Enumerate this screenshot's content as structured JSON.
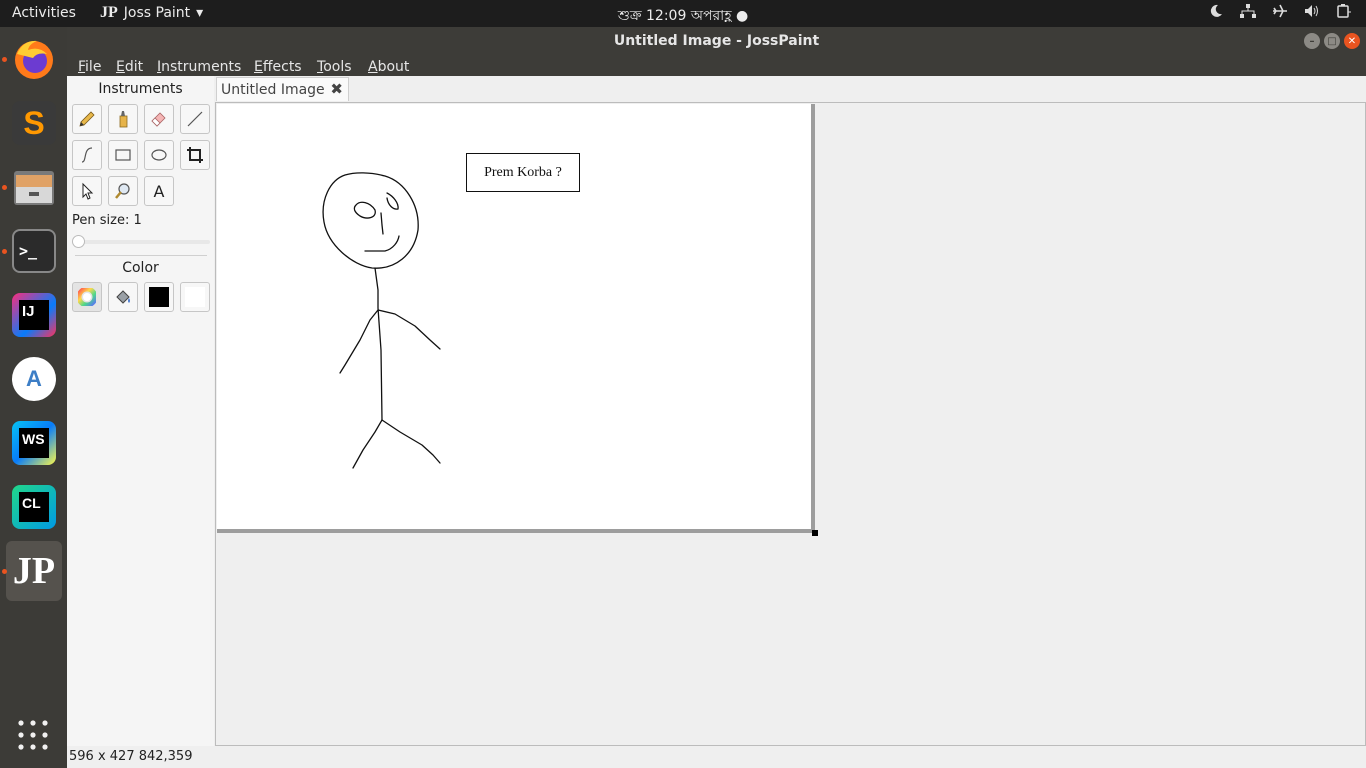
{
  "topbar": {
    "activities": "Activities",
    "app_name": "Joss Paint",
    "app_badge": "JP",
    "app_menu_arrow": "▾",
    "clock": "শুক্র 12:09 অপরাহ্ণ ●",
    "tray_icons": [
      "night-light-icon",
      "network-icon",
      "airplane-icon",
      "volume-icon",
      "battery-icon"
    ]
  },
  "dock": {
    "items": [
      {
        "name": "firefox",
        "running": true
      },
      {
        "name": "sublime-text",
        "running": false,
        "label": "S"
      },
      {
        "name": "files",
        "running": true
      },
      {
        "name": "terminal",
        "running": true,
        "label": ">_"
      },
      {
        "name": "intellij-idea",
        "running": false,
        "label": "IJ"
      },
      {
        "name": "android-studio",
        "running": false,
        "label": "A"
      },
      {
        "name": "webstorm",
        "running": false,
        "label": "WS"
      },
      {
        "name": "clion",
        "running": false,
        "label": "CL"
      },
      {
        "name": "josspaint",
        "running": true,
        "label": "JP"
      }
    ]
  },
  "window": {
    "title": "Untitled Image - JossPaint"
  },
  "menubar": {
    "items": [
      "File",
      "Edit",
      "Instruments",
      "Effects",
      "Tools",
      "About"
    ],
    "mnemonics": [
      "F",
      "E",
      "I",
      "E",
      "T",
      "A"
    ]
  },
  "panel": {
    "instruments_title": "Instruments",
    "text_tool_label": "A",
    "pen_size_label": "Pen size: 1",
    "pen_size_value": 1,
    "color_title": "Color",
    "primary_color": "#000000",
    "secondary_color": "#ffffff"
  },
  "tab": {
    "label": "Untitled Image",
    "close": "✖"
  },
  "canvas": {
    "speech_text": "Prem Korba ?"
  },
  "status": {
    "text": "596 x 427  842,359"
  },
  "colors": {
    "accent": "#e95420",
    "topbar": "#1d1d1d",
    "dock": "#3c3b37",
    "titlebar": "#3d3c38"
  }
}
